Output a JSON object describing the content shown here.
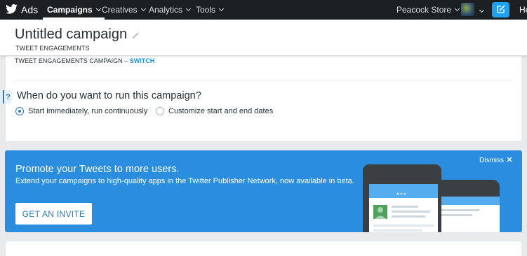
{
  "topnav": {
    "brand": "Ads",
    "items": [
      {
        "label": "Campaigns",
        "active": true
      },
      {
        "label": "Creatives",
        "active": false
      },
      {
        "label": "Analytics",
        "active": false
      },
      {
        "label": "Tools",
        "active": false
      }
    ],
    "account": "Peacock Store",
    "clipped_text": "He",
    "compose_icon": "compose-icon"
  },
  "campaign": {
    "title": "Untitled campaign",
    "objective": "TWEET ENGAGEMENTS",
    "campaign_type_text": "TWEET ENGAGEMENTS CAMPAIGN –",
    "switch_label": "SWITCH"
  },
  "schedule": {
    "help_label": "?",
    "question": "When do you want to run this campaign?",
    "options": [
      {
        "label": "Start immediately, run continuously",
        "selected": true
      },
      {
        "label": "Customize start and end dates",
        "selected": false
      }
    ]
  },
  "promo": {
    "title": "Promote your Tweets to more users.",
    "description": "Extend your campaigns to high-quality apps in the Twitter Publisher Network, now available in beta.",
    "button_label": "GET AN INVITE",
    "dismiss_label": "Dismiss"
  },
  "colors": {
    "nav_bg": "#1c2022",
    "accent": "#2b7bb9",
    "promo_bg": "#2b8ddd",
    "link": "#1b95e0"
  }
}
